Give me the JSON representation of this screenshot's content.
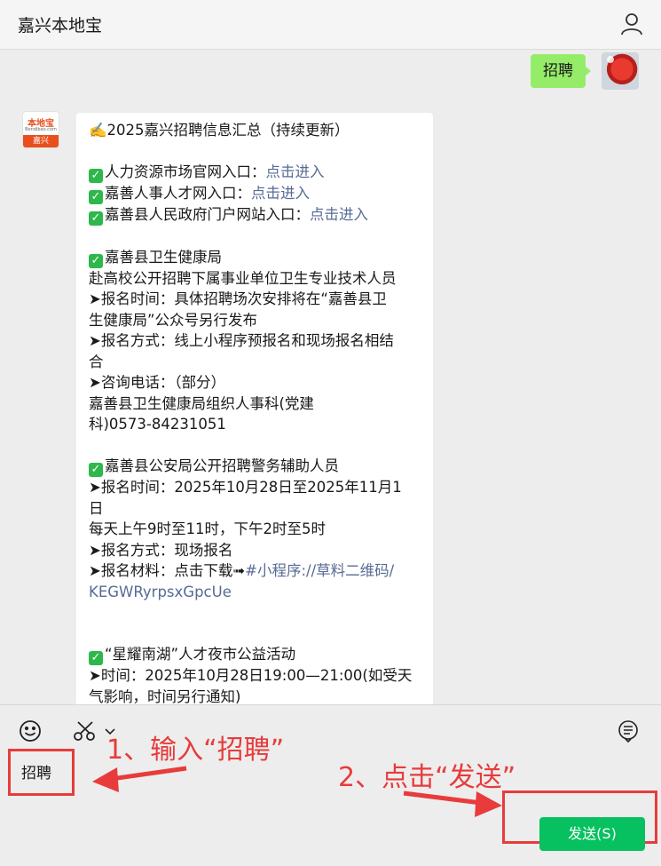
{
  "header": {
    "title": "嘉兴本地宝",
    "profile_icon": "person-icon"
  },
  "my_message": {
    "text": "招聘"
  },
  "bot_avatar": {
    "top": "本地宝",
    "middle": "Bendibao.com",
    "bottom": "嘉兴"
  },
  "message": {
    "intro": "✍️2025嘉兴招聘信息汇总（持续更新）",
    "entries": [
      {
        "label": "人力资源市场官网入口：",
        "link": "点击进入"
      },
      {
        "label": "嘉善人事人才网入口：",
        "link": "点击进入"
      },
      {
        "label": "嘉善县人民政府门户网站入口：",
        "link": "点击进入"
      }
    ],
    "section1": {
      "heading": "嘉善县卫生健康局",
      "lines": [
        "赴高校公开招聘下属事业单位卫生专业技术人员",
        "➤报名时间：具体招聘场次安排将在“嘉善县卫",
        "生健康局”公众号另行发布",
        "➤报名方式：线上小程序预报名和现场报名相结",
        "合",
        "➤咨询电话：（部分）",
        "嘉善县卫生健康局组织人事科(党建",
        "科)0573-84231051"
      ]
    },
    "section2": {
      "heading": "嘉善县公安局公开招聘警务辅助人员",
      "lines": [
        "➤报名时间：2025年10月28日至2025年11月1",
        "日",
        "每天上午9时至11时，下午2时至5时",
        "➤报名方式：现场报名"
      ],
      "material_prefix": "➤报名材料：点击下载➟",
      "material_link1": "#小程序://草料二维码/",
      "material_link2": "KEGWRyrpsxGpcUe"
    },
    "section3": {
      "heading": "“星耀南湖”人才夜市公益活动",
      "lines": [
        "➤时间：2025年10月28日19:00—21:00(如受天",
        "气影响，时间另行通知)"
      ]
    }
  },
  "input": {
    "value": "招聘"
  },
  "annotations": {
    "step1": "1、输入“招聘”",
    "step2": "2、点击“发送”",
    "color": "#e83b3b"
  },
  "send_button": {
    "label": "发送(S)",
    "color": "#07c160"
  },
  "toolbar": {
    "icons": [
      "emoji-icon",
      "scissors-icon",
      "chevron-down-icon",
      "chat-history-icon"
    ]
  }
}
